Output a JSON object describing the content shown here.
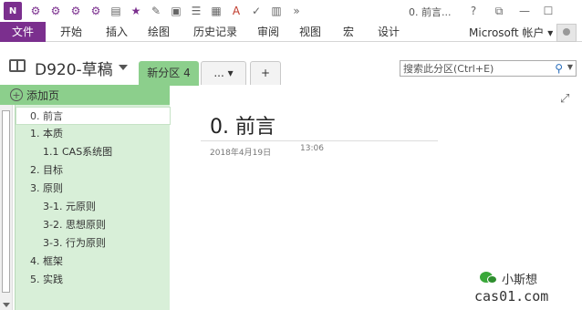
{
  "app": {
    "logo_text": "N",
    "doc_title": "0. 前言...",
    "window_controls": [
      "?",
      "⧉",
      "—",
      "☐"
    ]
  },
  "ribbon": {
    "tabs": [
      "文件",
      "开始",
      "插入",
      "绘图",
      "历史记录",
      "审阅",
      "视图",
      "宏",
      "设计"
    ],
    "account": "Microsoft 帐户",
    "account_caret": "▾",
    "accent_color": "#7b2f8e"
  },
  "notebook": {
    "name": "D920-草稿",
    "sections": [
      {
        "label": "新分区 4",
        "active": true
      },
      {
        "label": "... ▾",
        "active": false
      },
      {
        "label": "+",
        "active": false
      }
    ],
    "section_color": "#8ccf8c"
  },
  "search": {
    "placeholder": "搜索此分区(Ctrl+E)",
    "icon": "search-icon"
  },
  "pages": {
    "add_label": "添加页",
    "items": [
      {
        "label": "0. 前言",
        "level": 1,
        "selected": true
      },
      {
        "label": "1. 本质",
        "level": 1,
        "selected": false
      },
      {
        "label": "1.1 CAS系统图",
        "level": 2,
        "selected": false
      },
      {
        "label": "2. 目标",
        "level": 1,
        "selected": false
      },
      {
        "label": "3. 原则",
        "level": 1,
        "selected": false
      },
      {
        "label": "3-1. 元原则",
        "level": 2,
        "selected": false
      },
      {
        "label": "3-2. 思想原则",
        "level": 2,
        "selected": false
      },
      {
        "label": "3-3. 行为原则",
        "level": 2,
        "selected": false
      },
      {
        "label": "4. 框架",
        "level": 1,
        "selected": false
      },
      {
        "label": "5. 实践",
        "level": 1,
        "selected": false
      }
    ]
  },
  "content": {
    "title": "0. 前言",
    "date": "2018年4月19日",
    "time": "13:06"
  },
  "watermark": {
    "brand": "小斯想",
    "site": "cas01.com"
  }
}
